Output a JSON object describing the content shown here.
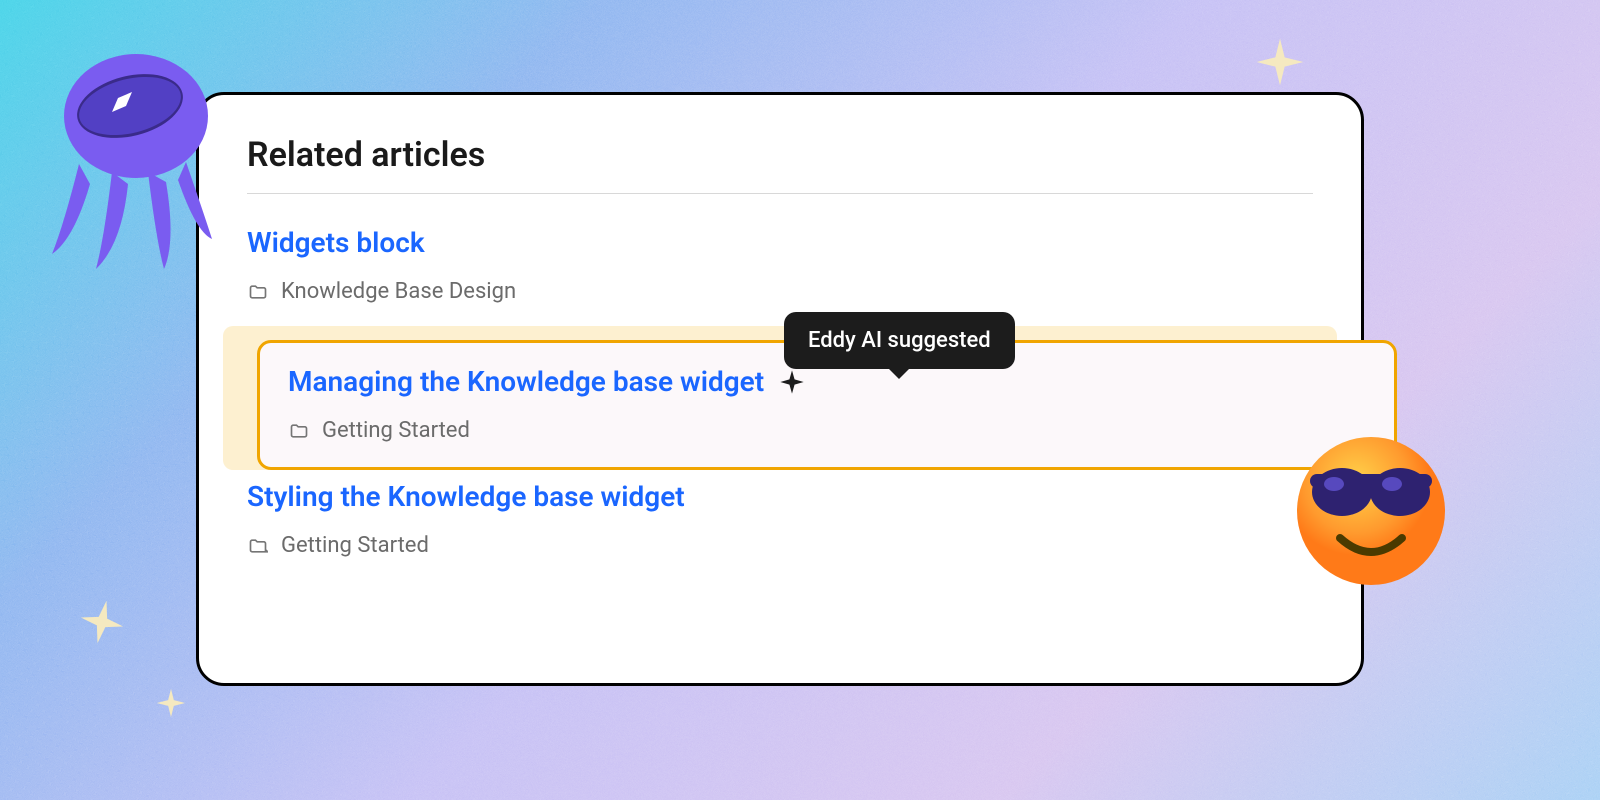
{
  "card": {
    "title": "Related articles"
  },
  "tooltip": {
    "text": "Eddy AI suggested"
  },
  "articles": [
    {
      "title": "Widgets block",
      "category": "Knowledge Base Design",
      "highlighted": false
    },
    {
      "title": "Managing the Knowledge base widget",
      "category": "Getting Started",
      "highlighted": true
    },
    {
      "title": "Styling the Knowledge base widget",
      "category": "Getting Started",
      "highlighted": false
    }
  ],
  "colors": {
    "link": "#1a66ff",
    "highlight_border": "#f0a500",
    "highlight_bg": "#fdf0d0"
  }
}
